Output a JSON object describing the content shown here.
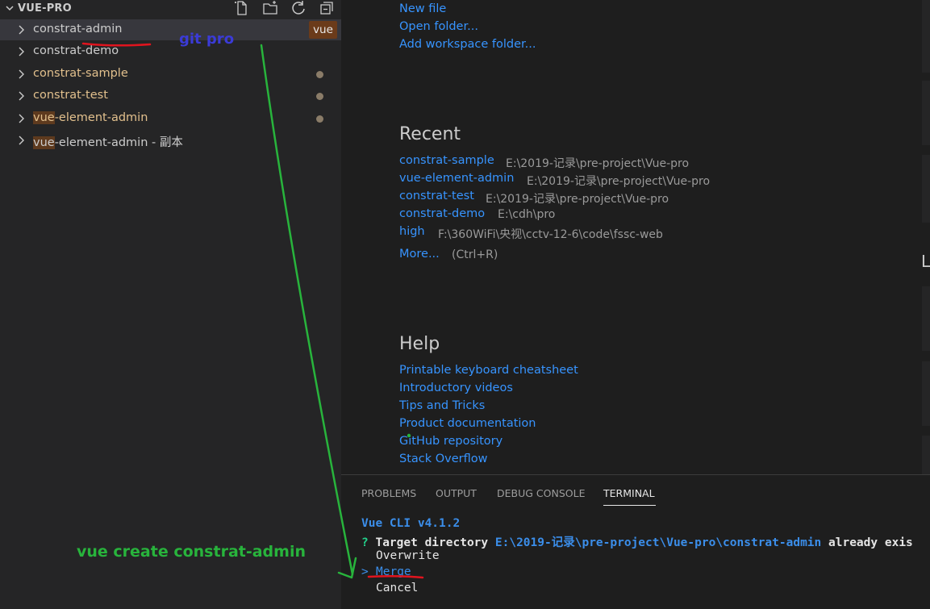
{
  "sidebar": {
    "title": "VUE-PRO",
    "toolbar_icons": [
      "new-file-icon",
      "new-folder-icon",
      "refresh-icon",
      "collapse-all-icon"
    ],
    "items": [
      {
        "label": "constrat-admin",
        "status": "default",
        "badge": "vue",
        "active": true
      },
      {
        "label": "constrat-demo",
        "status": "default"
      },
      {
        "label": "constrat-sample",
        "status": "modified",
        "dot": true
      },
      {
        "label": "constrat-test",
        "status": "modified",
        "dot": true
      },
      {
        "label_highlight": "vue",
        "label_rest": "-element-admin",
        "status": "modified",
        "dot": true
      },
      {
        "label_highlight": "vue",
        "label_rest": "-element-admin - 副本",
        "status": "default"
      }
    ]
  },
  "welcome": {
    "start_links": [
      "New file",
      "Open folder...",
      "Add workspace folder..."
    ],
    "recent": {
      "title": "Recent",
      "items": [
        {
          "name": "constrat-sample",
          "path": "E:\\2019-记录\\pre-project\\Vue-pro"
        },
        {
          "name": "vue-element-admin",
          "path": "E:\\2019-记录\\pre-project\\Vue-pro"
        },
        {
          "name": "constrat-test",
          "path": "E:\\2019-记录\\pre-project\\Vue-pro"
        },
        {
          "name": "constrat-demo",
          "path": "E:\\cdh\\pro"
        },
        {
          "name": "high",
          "path": "F:\\360WiFi\\央视\\cctv-12-6\\code\\fssc-web"
        }
      ],
      "more": "More...",
      "more_shortcut": "(Ctrl+R)"
    },
    "help": {
      "title": "Help",
      "links": [
        "Printable keyboard cheatsheet",
        "Introductory videos",
        "Tips and Tricks",
        "Product documentation",
        "GitHub repository",
        "Stack Overflow"
      ]
    },
    "right_letter": "L"
  },
  "panel": {
    "tabs": [
      "PROBLEMS",
      "OUTPUT",
      "DEBUG CONSOLE",
      "TERMINAL"
    ],
    "active_tab": "TERMINAL",
    "terminal": {
      "line1": "Vue CLI v4.1.2",
      "prompt_mark": "?",
      "prompt_label": "Target directory",
      "prompt_path": "E:\\2019-记录\\pre-project\\Vue-pro\\constrat-admin",
      "prompt_tail": "already exis",
      "options": [
        "Overwrite",
        "Merge",
        "Cancel"
      ],
      "selected_option": "Merge",
      "selector": ">"
    }
  },
  "annotations": {
    "git_label": "git pro",
    "command_label": "vue create constrat-admin",
    "colors": {
      "blue": "#3b3bd6",
      "green": "#28b43c",
      "red": "#e0141e"
    }
  }
}
